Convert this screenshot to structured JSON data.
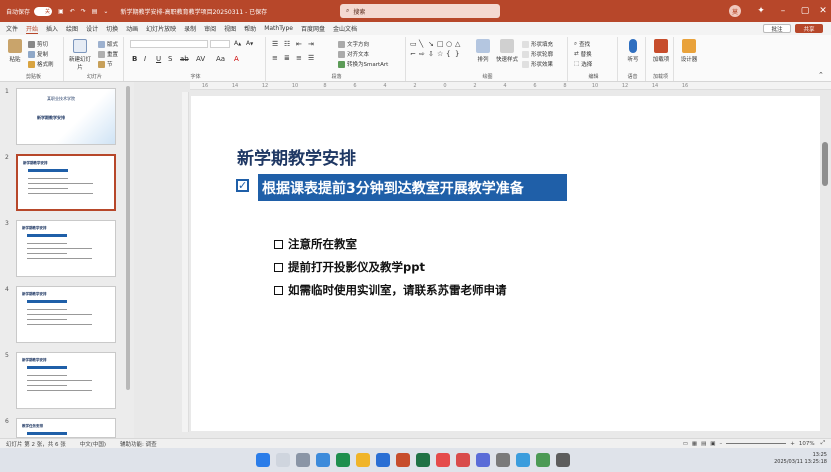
{
  "titlebar": {
    "autosave_label": "自动保存",
    "autosave_state": "关",
    "file_name": "新学期教学安排-高职教育教学项目20250311 - 已保存",
    "search_placeholder": "搜索",
    "user_initial": "莫"
  },
  "tabs": [
    "文件",
    "开始",
    "插入",
    "绘图",
    "设计",
    "切换",
    "动画",
    "幻灯片放映",
    "录制",
    "审阅",
    "视图",
    "帮助",
    "MathType",
    "百度网盘",
    "金山文档"
  ],
  "active_tab": "开始",
  "share_buttons": {
    "comment": "批注",
    "share": "共享"
  },
  "ribbon": {
    "clipboard": {
      "paste": "粘贴",
      "cut": "剪切",
      "copy": "复制",
      "format_painter": "格式刷",
      "label": "剪贴板"
    },
    "slides": {
      "new_slide": "新建幻灯片",
      "layout": "版式",
      "reset": "重置",
      "section": "节",
      "reuse": "重用幻灯片",
      "label": "幻灯片"
    },
    "font": {
      "label": "字体",
      "font_name": "",
      "font_size": ""
    },
    "paragraph": {
      "label": "段落",
      "text_direction": "文字方向",
      "align_text": "对齐文本",
      "smartart": "转换为SmartArt"
    },
    "drawing": {
      "label": "绘图",
      "arrange": "排列",
      "quick_styles": "快速样式",
      "fill": "形状填充",
      "outline": "形状轮廓",
      "effects": "形状效果"
    },
    "editing": {
      "label": "编辑",
      "find": "查找",
      "replace": "替换",
      "select": "选择"
    },
    "voice": {
      "dictate": "听写",
      "label": "语音"
    },
    "addins": {
      "addins": "加载项",
      "label": "加载项"
    },
    "designer": {
      "designer": "设计器"
    }
  },
  "ruler_marks": [
    "16",
    "14",
    "12",
    "10",
    "8",
    "6",
    "4",
    "2",
    "0",
    "2",
    "4",
    "6",
    "8",
    "10",
    "12",
    "14",
    "16"
  ],
  "thumbnails": [
    {
      "num": "1",
      "title": "某职业技术学院",
      "subtitle": "新学期教学安排"
    },
    {
      "num": "2",
      "title": "新学期教学安排"
    },
    {
      "num": "3",
      "title": "新学期教学安排"
    },
    {
      "num": "4",
      "title": "新学期教学安排"
    },
    {
      "num": "5",
      "title": "新学期教学安排"
    },
    {
      "num": "6",
      "title": "教学任务安排"
    }
  ],
  "slide": {
    "title": "新学期教学安排",
    "highlight": "根据课表提前3分钟到达教室开展教学准备",
    "bullets": [
      "注意所在教室",
      "提前打开投影仪及教学ppt",
      "如需临时使用实训室，请联系苏雷老师申请"
    ]
  },
  "status": {
    "slide_pos": "幻灯片 第 2 张，共 6 张",
    "language": "中文(中国)",
    "accessibility": "辅助功能: 调查",
    "zoom": "107%"
  },
  "taskbar": {
    "time": "13:25",
    "date": "2025/03/11 13:25:18"
  }
}
